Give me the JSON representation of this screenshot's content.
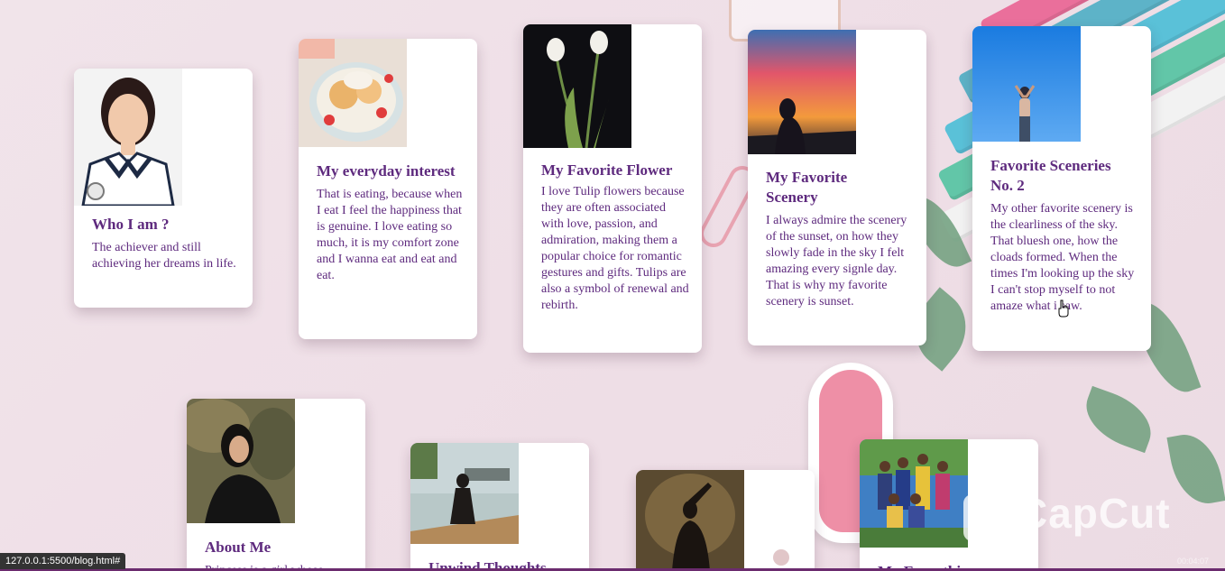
{
  "page": {
    "background_color": "#efdfe7",
    "accent_color": "#5e2a7e"
  },
  "cards": [
    {
      "title": "Who I am ?",
      "text": "The achiever and still achieving her dreams in life.",
      "photo": "portrait-photo"
    },
    {
      "title": "My everyday interest",
      "text": "That is eating, because when I eat I feel the happiness that is genuine. I love eating so much, it is my comfort zone and I wanna eat and eat and eat.",
      "photo": "food-photo"
    },
    {
      "title": "My Favorite Flower",
      "text": "I love Tulip flowers because they are often associated with love, passion, and admiration, making them a popular choice for romantic gestures and gifts. Tulips are also a symbol of renewal and rebirth.",
      "photo": "tulip-photo"
    },
    {
      "title": "My Favorite Scenery",
      "text": "I always admire the scenery of the sunset, on how they slowly fade in the sky I felt amazing every signle day. That is why my favorite scenery is sunset.",
      "photo": "sunset-photo"
    },
    {
      "title": "Favorite Sceneries No. 2",
      "text": "My other favorite scenery is the clearliness of the sky. That bluesh one, how the cloads formed. When the times I'm looking up the sky I can't stop myself to not amaze what i saw.",
      "photo": "sky-photo"
    },
    {
      "title": "About Me",
      "text": "Princess is a girl whose",
      "photo": "about-me-photo"
    },
    {
      "title": "Unwind Thoughts",
      "text": "",
      "photo": "lake-photo"
    },
    {
      "title": "",
      "text": "",
      "photo": "dancer-photo"
    },
    {
      "title": "My Everything",
      "text": "",
      "photo": "family-photo"
    }
  ],
  "status_bar": {
    "url": "127.0.0.1:5500/blog.html#",
    "time": "00:04:07"
  },
  "watermark": "CapCut"
}
